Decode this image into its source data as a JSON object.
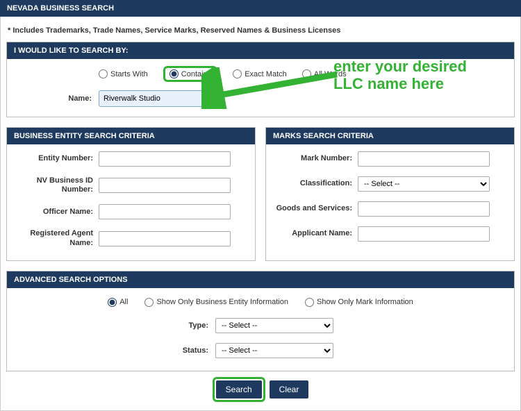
{
  "page_title": "NEVADA BUSINESS SEARCH",
  "note": "* Includes Trademarks, Trade Names, Service Marks, Reserved Names & Business Licenses",
  "search_by": {
    "header": "I WOULD LIKE TO SEARCH BY:",
    "options": {
      "starts_with": "Starts With",
      "contains": "Contains",
      "exact_match": "Exact Match",
      "all_words": "All Words"
    },
    "name_label": "Name:",
    "name_value": "Riverwalk Studio"
  },
  "entity": {
    "header": "BUSINESS ENTITY SEARCH CRITERIA",
    "entity_number": "Entity Number:",
    "nv_business_id": "NV Business ID Number:",
    "officer_name": "Officer Name:",
    "registered_agent": "Registered Agent Name:"
  },
  "marks": {
    "header": "MARKS SEARCH CRITERIA",
    "mark_number": "Mark Number:",
    "classification": "Classification:",
    "classification_placeholder": "-- Select --",
    "goods_services": "Goods and Services:",
    "applicant_name": "Applicant Name:"
  },
  "advanced": {
    "header": "ADVANCED SEARCH OPTIONS",
    "all": "All",
    "only_entity": "Show Only Business Entity Information",
    "only_mark": "Show Only Mark Information",
    "type_label": "Type:",
    "type_placeholder": "-- Select --",
    "status_label": "Status:",
    "status_placeholder": "-- Select --"
  },
  "buttons": {
    "search": "Search",
    "clear": "Clear"
  },
  "annotation": {
    "line1": "enter your desired",
    "line2": "LLC name here"
  }
}
